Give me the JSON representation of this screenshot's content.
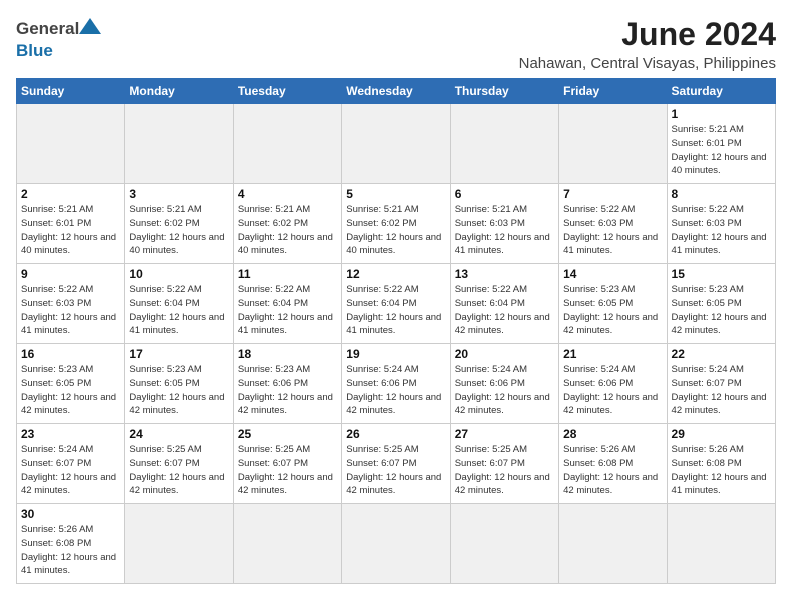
{
  "header": {
    "logo_general": "General",
    "logo_blue": "Blue",
    "month_year": "June 2024",
    "location": "Nahawan, Central Visayas, Philippines"
  },
  "days_of_week": [
    "Sunday",
    "Monday",
    "Tuesday",
    "Wednesday",
    "Thursday",
    "Friday",
    "Saturday"
  ],
  "weeks": [
    [
      {
        "day": "",
        "empty": true
      },
      {
        "day": "",
        "empty": true
      },
      {
        "day": "",
        "empty": true
      },
      {
        "day": "",
        "empty": true
      },
      {
        "day": "",
        "empty": true
      },
      {
        "day": "",
        "empty": true
      },
      {
        "day": "1",
        "sunrise": "5:21 AM",
        "sunset": "6:01 PM",
        "daylight": "12 hours and 40 minutes."
      }
    ],
    [
      {
        "day": "2",
        "sunrise": "5:21 AM",
        "sunset": "6:01 PM",
        "daylight": "12 hours and 40 minutes."
      },
      {
        "day": "3",
        "sunrise": "5:21 AM",
        "sunset": "6:02 PM",
        "daylight": "12 hours and 40 minutes."
      },
      {
        "day": "4",
        "sunrise": "5:21 AM",
        "sunset": "6:02 PM",
        "daylight": "12 hours and 40 minutes."
      },
      {
        "day": "5",
        "sunrise": "5:21 AM",
        "sunset": "6:02 PM",
        "daylight": "12 hours and 40 minutes."
      },
      {
        "day": "6",
        "sunrise": "5:21 AM",
        "sunset": "6:03 PM",
        "daylight": "12 hours and 41 minutes."
      },
      {
        "day": "7",
        "sunrise": "5:22 AM",
        "sunset": "6:03 PM",
        "daylight": "12 hours and 41 minutes."
      },
      {
        "day": "8",
        "sunrise": "5:22 AM",
        "sunset": "6:03 PM",
        "daylight": "12 hours and 41 minutes."
      }
    ],
    [
      {
        "day": "9",
        "sunrise": "5:22 AM",
        "sunset": "6:03 PM",
        "daylight": "12 hours and 41 minutes."
      },
      {
        "day": "10",
        "sunrise": "5:22 AM",
        "sunset": "6:04 PM",
        "daylight": "12 hours and 41 minutes."
      },
      {
        "day": "11",
        "sunrise": "5:22 AM",
        "sunset": "6:04 PM",
        "daylight": "12 hours and 41 minutes."
      },
      {
        "day": "12",
        "sunrise": "5:22 AM",
        "sunset": "6:04 PM",
        "daylight": "12 hours and 41 minutes."
      },
      {
        "day": "13",
        "sunrise": "5:22 AM",
        "sunset": "6:04 PM",
        "daylight": "12 hours and 42 minutes."
      },
      {
        "day": "14",
        "sunrise": "5:23 AM",
        "sunset": "6:05 PM",
        "daylight": "12 hours and 42 minutes."
      },
      {
        "day": "15",
        "sunrise": "5:23 AM",
        "sunset": "6:05 PM",
        "daylight": "12 hours and 42 minutes."
      }
    ],
    [
      {
        "day": "16",
        "sunrise": "5:23 AM",
        "sunset": "6:05 PM",
        "daylight": "12 hours and 42 minutes."
      },
      {
        "day": "17",
        "sunrise": "5:23 AM",
        "sunset": "6:05 PM",
        "daylight": "12 hours and 42 minutes."
      },
      {
        "day": "18",
        "sunrise": "5:23 AM",
        "sunset": "6:06 PM",
        "daylight": "12 hours and 42 minutes."
      },
      {
        "day": "19",
        "sunrise": "5:24 AM",
        "sunset": "6:06 PM",
        "daylight": "12 hours and 42 minutes."
      },
      {
        "day": "20",
        "sunrise": "5:24 AM",
        "sunset": "6:06 PM",
        "daylight": "12 hours and 42 minutes."
      },
      {
        "day": "21",
        "sunrise": "5:24 AM",
        "sunset": "6:06 PM",
        "daylight": "12 hours and 42 minutes."
      },
      {
        "day": "22",
        "sunrise": "5:24 AM",
        "sunset": "6:07 PM",
        "daylight": "12 hours and 42 minutes."
      }
    ],
    [
      {
        "day": "23",
        "sunrise": "5:24 AM",
        "sunset": "6:07 PM",
        "daylight": "12 hours and 42 minutes."
      },
      {
        "day": "24",
        "sunrise": "5:25 AM",
        "sunset": "6:07 PM",
        "daylight": "12 hours and 42 minutes."
      },
      {
        "day": "25",
        "sunrise": "5:25 AM",
        "sunset": "6:07 PM",
        "daylight": "12 hours and 42 minutes."
      },
      {
        "day": "26",
        "sunrise": "5:25 AM",
        "sunset": "6:07 PM",
        "daylight": "12 hours and 42 minutes."
      },
      {
        "day": "27",
        "sunrise": "5:25 AM",
        "sunset": "6:07 PM",
        "daylight": "12 hours and 42 minutes."
      },
      {
        "day": "28",
        "sunrise": "5:26 AM",
        "sunset": "6:08 PM",
        "daylight": "12 hours and 42 minutes."
      },
      {
        "day": "29",
        "sunrise": "5:26 AM",
        "sunset": "6:08 PM",
        "daylight": "12 hours and 41 minutes."
      }
    ],
    [
      {
        "day": "30",
        "sunrise": "5:26 AM",
        "sunset": "6:08 PM",
        "daylight": "12 hours and 41 minutes."
      },
      {
        "day": "",
        "empty": true
      },
      {
        "day": "",
        "empty": true
      },
      {
        "day": "",
        "empty": true
      },
      {
        "day": "",
        "empty": true
      },
      {
        "day": "",
        "empty": true
      },
      {
        "day": "",
        "empty": true
      }
    ]
  ],
  "labels": {
    "sunrise": "Sunrise:",
    "sunset": "Sunset:",
    "daylight": "Daylight:"
  }
}
